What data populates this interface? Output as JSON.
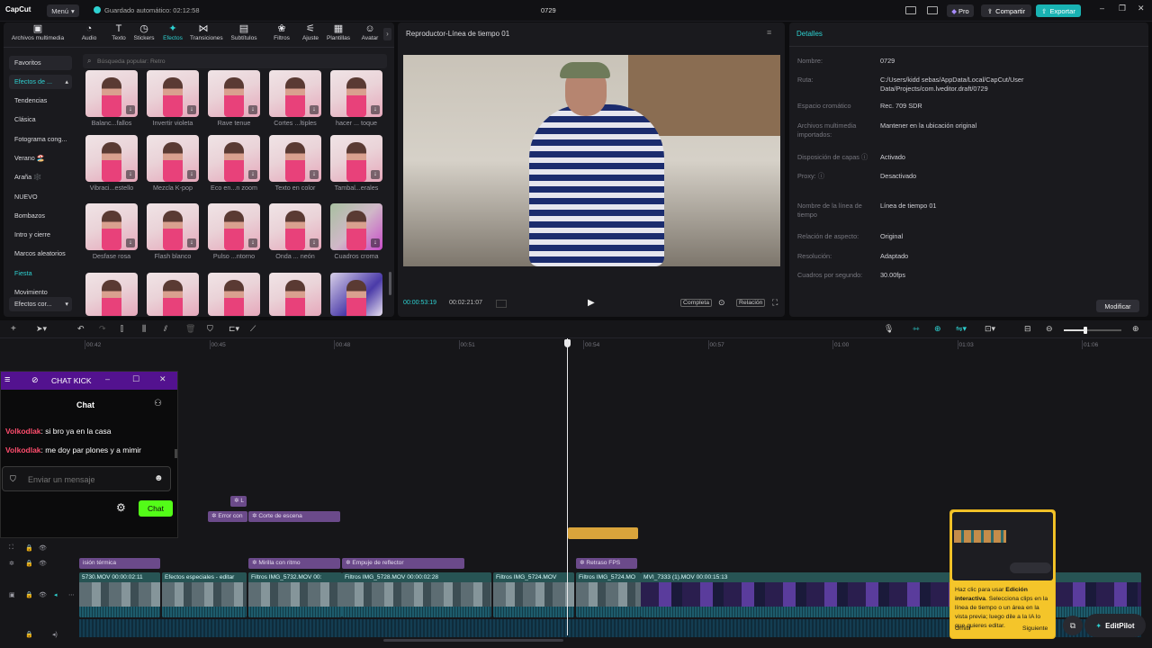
{
  "app": {
    "logo": "CapCut",
    "menu": "Menú",
    "autosave": "Guardado automático: 02:12:58",
    "project": "0729",
    "pro": "Pro",
    "share": "Compartir",
    "export": "Exportar"
  },
  "toolbar": [
    {
      "label": "Archivos multimedia",
      "icon": "media-icon"
    },
    {
      "label": "Audio",
      "icon": "audio-icon"
    },
    {
      "label": "Texto",
      "icon": "text-icon"
    },
    {
      "label": "Stickers",
      "icon": "sticker-icon"
    },
    {
      "label": "Efectos",
      "icon": "effects-icon",
      "active": true
    },
    {
      "label": "Transiciones",
      "icon": "transition-icon"
    },
    {
      "label": "Subtítulos",
      "icon": "subtitle-icon"
    },
    {
      "label": "Filtros",
      "icon": "filter-icon"
    },
    {
      "label": "Ajuste",
      "icon": "adjust-icon"
    },
    {
      "label": "Plantillas",
      "icon": "template-icon"
    },
    {
      "label": "Avatar",
      "icon": "avatar-icon"
    }
  ],
  "sidebar": {
    "favorites": "Favoritos",
    "group": "Efectos de ...",
    "items": [
      "Tendencias",
      "Clásica",
      "Fotograma cong...",
      "Verano 🏖️",
      "Araña 🕸️",
      "NUEVO",
      "Bombazos",
      "Intro y cierre",
      "Marcos aleatorios",
      "Fiesta",
      "Movimiento"
    ],
    "dropdown": "Efectos cor..."
  },
  "search": {
    "placeholder": "Búsqueda popular: Retro"
  },
  "effects": [
    "Balanc...fallos",
    "Invertir violeta",
    "Rave tenue",
    "Cortes ...ltiples",
    "hacer ... toque",
    "Vibraci...estello",
    "Mezcla K-pop",
    "Eco en...n zoom",
    "Texto en color",
    "Tambal...erales",
    "Desfase rosa",
    "Flash blanco",
    "Pulso ...ntorno",
    "Onda ... neón",
    "Cuadros croma"
  ],
  "player": {
    "title": "Reproductor-Línea de tiempo 01",
    "current": "00:00:53:19",
    "total": "00:02:21:07",
    "full": "Completa",
    "ratio": "Relación"
  },
  "details": {
    "title": "Detalles",
    "rows": [
      {
        "k": "Nombre:",
        "v": "0729"
      },
      {
        "k": "Ruta:",
        "v": "C:/Users/kidd sebas/AppData/Local/CapCut/User Data/Projects/com.lveditor.draft/0729"
      },
      {
        "k": "Espacio cromático",
        "v": "Rec. 709 SDR"
      },
      {
        "k": "Archivos multimedia importados:",
        "v": "Mantener en la ubicación original"
      },
      {
        "k": "Disposición de capas ⓘ",
        "v": "Activado"
      },
      {
        "k": "Proxy: ⓘ",
        "v": "Desactivado"
      },
      {
        "k": "Nombre de la línea de tiempo",
        "v": "Línea de tiempo 01"
      },
      {
        "k": "Relación de aspecto:",
        "v": "Original"
      },
      {
        "k": "Resolución:",
        "v": "Adaptado"
      },
      {
        "k": "Cuadros por segundo:",
        "v": "30.00fps"
      }
    ],
    "modify": "Modificar"
  },
  "ruler": [
    "00:42",
    "00:45",
    "00:48",
    "00:51",
    "00:54",
    "00:57",
    "01:00",
    "01:03",
    "01:06"
  ],
  "chat": {
    "title": "CHAT KICK",
    "header": "Chat",
    "messages": [
      {
        "user": "Volkodlak",
        "text": ": si bro ya en la casa"
      },
      {
        "user": "Volkodlak",
        "text": ": me doy par plones y a mimir"
      }
    ],
    "placeholder": "Enviar un mensaje",
    "send": "Chat"
  },
  "fx_clips": {
    "top": [
      "Error con",
      "Corte de escena"
    ],
    "row": [
      "isión térmica",
      "Mirilla con ritmo",
      "Empuje de reflector",
      "Retraso FPS"
    ]
  },
  "main_clips": [
    "5730.MOV  00:00:02:11",
    "Efectos especiales - editar",
    "Filtros  IMG_5732.MOV  00:",
    "Filtros  IMG_5728.MOV  00:00:02:28",
    "Filtros  IMG_5724.MOV",
    "Filtros  IMG_5724.MO",
    "MVI_7333 (1).MOV  00:00:15:13"
  ],
  "tooltip": {
    "text1": "Haz clic para usar ",
    "bold": "Edición interactiva",
    "text2": ". Selecciona clips en la línea de tiempo o un área en la vista previa; luego dile a la IA lo que quieres editar.",
    "omit": "Omitir",
    "next": "Siguiente"
  },
  "editpilot": "EditPilot",
  "colors": {
    "accent": "#2ed1d1",
    "kick_purple": "#53128f",
    "kick_green": "#53fc18",
    "username": "#ff4d6d"
  }
}
